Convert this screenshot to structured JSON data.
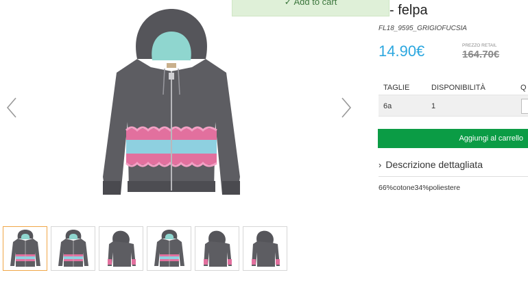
{
  "toast": {
    "message": "✓ Add to cart"
  },
  "product": {
    "title_visible": "- felpa",
    "sku": "FL18_9595_GRIGIOFUCSIA",
    "price": "14.90€",
    "retail_label": "PREZZO RETAIL",
    "retail_price": "164.70€",
    "composition": "66%cotone34%poliestere"
  },
  "sizes_table": {
    "headers": [
      "TAGLIE",
      "DISPONIBILITÀ",
      "Q"
    ],
    "rows": [
      {
        "size": "6a",
        "availability": "1"
      }
    ]
  },
  "cart_button": {
    "label": "Aggiungi al carrello"
  },
  "description": {
    "label": "Descrizione dettagliata",
    "chevron_icon": "chevron-right-icon"
  },
  "gallery": {
    "arrows": [
      "chevron-left-icon",
      "chevron-right-icon"
    ],
    "thumbnails": [
      "front",
      "front",
      "back",
      "front",
      "back",
      "back"
    ],
    "active_thumbnail": 0
  },
  "colors": {
    "price": "#2ca7df",
    "cart_button": "#0b9c45",
    "active_thumb_border": "#f0a646",
    "toast_bg": "#dff0d8",
    "hoodie": "#5a5a5f",
    "lining": "#8fd6cf",
    "lace_pink": "#e2709e",
    "lace_blue": "#8ed0e0"
  }
}
